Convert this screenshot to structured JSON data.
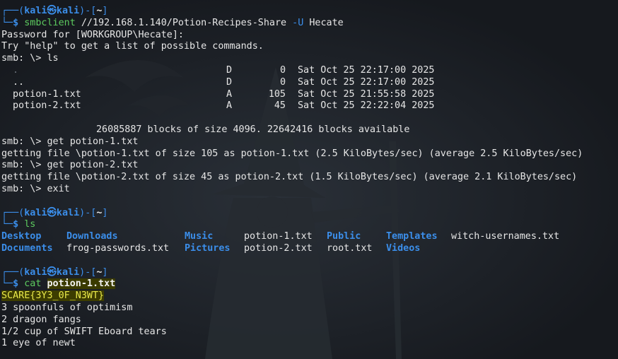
{
  "prompt": {
    "user_host": "kali㉿kali",
    "path": "~",
    "symbol": "$"
  },
  "session1": {
    "command": "smbclient",
    "args": "//192.168.1.140/Potion-Recipes-Share",
    "flag": "-U",
    "flag_value": "Hecate",
    "output": [
      "Password for [WORKGROUP\\Hecate]:",
      "Try \"help\" to get a list of possible commands."
    ],
    "smb_prompt": "smb: \\>",
    "ls_cmd": "ls",
    "listing": [
      {
        "name": ".",
        "attr": "D",
        "size": "0",
        "date": "Sat Oct 25 22:17:00 2025"
      },
      {
        "name": "..",
        "attr": "D",
        "size": "0",
        "date": "Sat Oct 25 22:17:00 2025"
      },
      {
        "name": "potion-1.txt",
        "attr": "A",
        "size": "105",
        "date": "Sat Oct 25 21:55:58 2025"
      },
      {
        "name": "potion-2.txt",
        "attr": "A",
        "size": "45",
        "date": "Sat Oct 25 22:22:04 2025"
      }
    ],
    "blocks": "26085887 blocks of size 4096. 22642416 blocks available",
    "get1_cmd": "get potion-1.txt",
    "get1_out": "getting file \\potion-1.txt of size 105 as potion-1.txt (2.5 KiloBytes/sec) (average 2.5 KiloBytes/sec)",
    "get2_cmd": "get potion-2.txt",
    "get2_out": "getting file \\potion-2.txt of size 45 as potion-2.txt (1.5 KiloBytes/sec) (average 2.1 KiloBytes/sec)",
    "exit_cmd": "exit"
  },
  "session2": {
    "command": "ls",
    "row1": [
      "Desktop",
      "Downloads",
      "Music",
      "potion-1.txt",
      "Public",
      "Templates",
      "witch-usernames.txt"
    ],
    "row2": [
      "Documents",
      "frog-passwords.txt",
      "Pictures",
      "potion-2.txt",
      "root.txt",
      "Videos"
    ]
  },
  "session3": {
    "command": "cat",
    "arg": "potion-1.txt",
    "output": [
      "SCARE{3Y3_0F_N3WT}",
      "3 spoonfuls of optimism",
      "2 dragon fangs",
      "1/2 cup of SWIFT Eboard tears",
      "1 eye of newt"
    ]
  },
  "colors": {
    "accent": "#3b8eea",
    "command": "#5dcb5f",
    "background": "#1b1f25"
  }
}
